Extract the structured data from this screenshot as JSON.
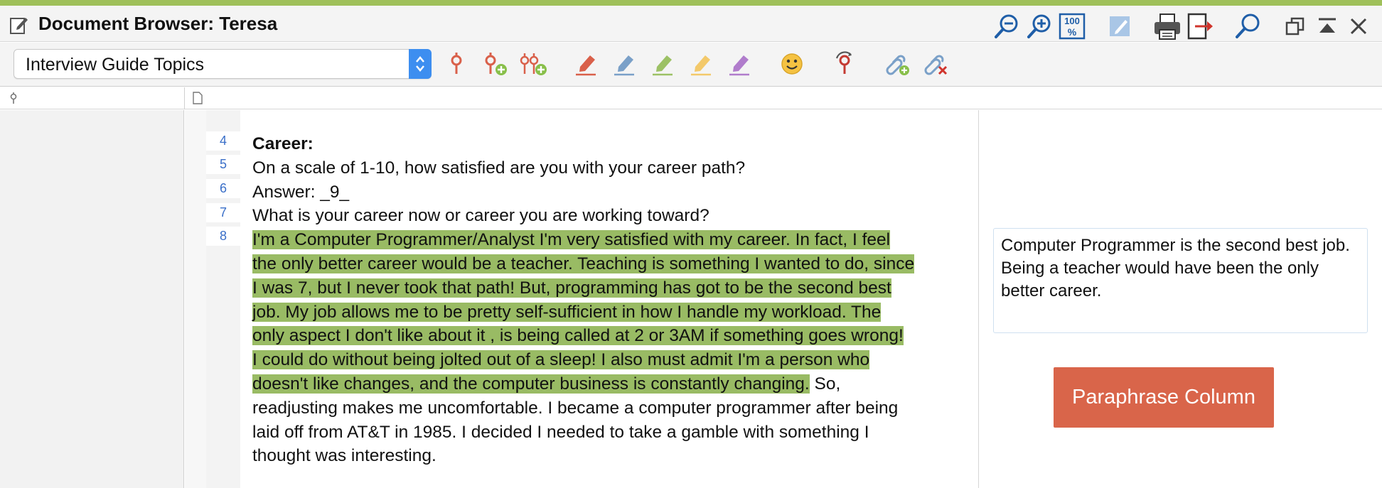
{
  "window": {
    "title": "Document Browser: Teresa"
  },
  "toolbar": {
    "dropdown_value": "Interview Guide Topics",
    "icons": [
      "code-icon",
      "add-code-icon",
      "add-multiple-codes-icon",
      "red-highlighter-icon",
      "blue-highlighter-icon",
      "green-highlighter-icon",
      "yellow-highlighter-icon",
      "purple-highlighter-icon",
      "emoticon-icon",
      "code-link-icon",
      "add-link-icon",
      "remove-link-icon"
    ]
  },
  "title_icons": [
    "zoom-out-icon",
    "zoom-in-icon",
    "zoom-100-icon",
    "edit-icon",
    "print-icon",
    "export-icon",
    "search-icon",
    "restore-window-icon",
    "minimize-window-icon",
    "close-icon"
  ],
  "document": {
    "line_numbers": [
      "4",
      "5",
      "6",
      "7",
      "8"
    ],
    "lines": [
      "Career:",
      "On a scale of 1-10, how satisfied are you with your career path?",
      "Answer: _9_",
      "What is your career now or career you are working toward?"
    ],
    "paragraph_highlighted": [
      "I'm a Computer Programmer/Analyst I'm very satisfied with my career.  In fact, I feel",
      "the only better career would be a teacher.  Teaching is something I wanted to do, since",
      "I was 7, but I never took that path!  But, programming has got to be the second best",
      "job.  My job allows me to be pretty self-sufficient in how I handle my workload.  The",
      "only aspect I don't like about it , is being called at 2 or 3AM  if something goes wrong!",
      "I could do without being jolted out of a sleep!  I also must admit I'm a person who",
      "doesn't like changes, and the computer business is constantly changing."
    ],
    "paragraph_rest_inline": " So,",
    "paragraph_rest": [
      "readjusting makes me uncomfortable.  I became a computer programmer after being",
      "laid off from AT&T in 1985.  I decided I needed to take a gamble with something I",
      "thought was interesting."
    ]
  },
  "paraphrase": {
    "text": "Computer Programmer is the second best job. Being a teacher would have been the only better career.",
    "button_label": "Paraphrase Column"
  },
  "colors": {
    "highlight": "#99bb64",
    "accent_stripe": "#9fc05a",
    "button": "#d9654a",
    "dropdown_arrow": "#3d8ef0"
  }
}
